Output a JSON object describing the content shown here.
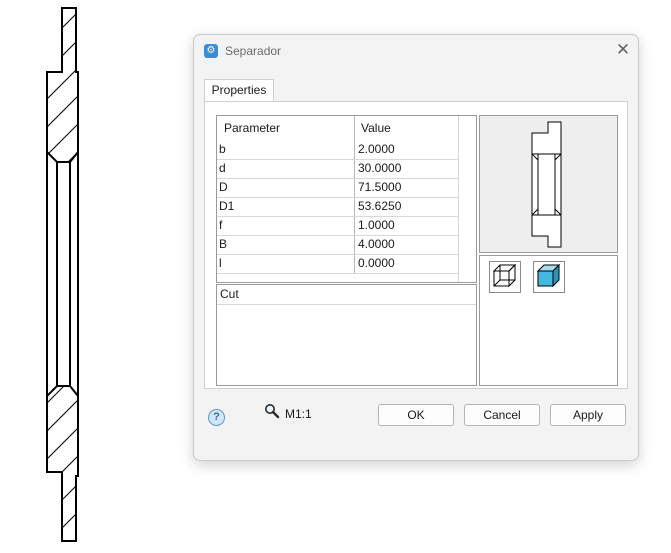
{
  "dialog": {
    "title": "Separador",
    "close_glyph": "✕",
    "icon": "gear-icon",
    "tabs": [
      {
        "label": "Properties",
        "active": true
      }
    ]
  },
  "parameters": {
    "columns": [
      "Parameter",
      "Value"
    ],
    "rows": [
      {
        "name": "b",
        "value": "2.0000"
      },
      {
        "name": "d",
        "value": "30.0000"
      },
      {
        "name": "D",
        "value": "71.5000"
      },
      {
        "name": "D1",
        "value": "53.6250"
      },
      {
        "name": "f",
        "value": "1.0000"
      },
      {
        "name": "B",
        "value": "4.0000"
      },
      {
        "name": "l",
        "value": "0.0000"
      }
    ]
  },
  "cut": {
    "label": "Cut"
  },
  "footer": {
    "help_glyph": "?",
    "scale": "M1:1",
    "ok_label": "OK",
    "cancel_label": "Cancel",
    "apply_label": "Apply"
  },
  "colors": {
    "accent": "#3a8ed6",
    "view_selected_fill": "#45b8e0",
    "dialog_background": "#f3f3f3"
  }
}
